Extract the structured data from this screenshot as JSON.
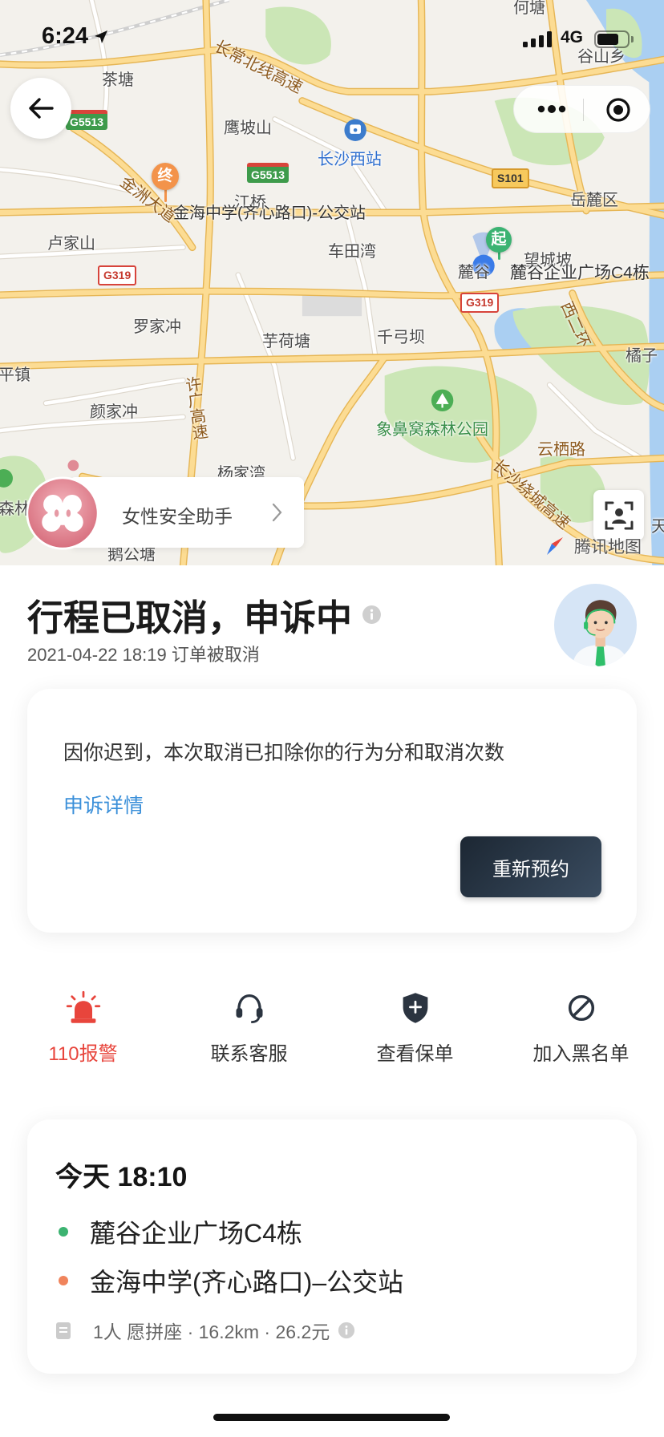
{
  "status_bar": {
    "time": "6:24",
    "network": "4G"
  },
  "map": {
    "labels": [
      "何塘",
      "谷山乡",
      "茶塘",
      "长常北线高速",
      "鹰坡山",
      "长沙西站",
      "岳麓区",
      "金洲大道",
      "江桥",
      "金海中学(齐心路口)-公交站",
      "卢家山",
      "车田湾",
      "望城坡",
      "麓谷",
      "麓谷企业广场C4栋",
      "罗家冲",
      "芋荷塘",
      "千弓坝",
      "西二环",
      "橘子",
      "平镇",
      "颜家冲",
      "许广高速",
      "象鼻窝森林公园",
      "云栖路",
      "长沙绕城高速",
      "杨家湾",
      "森林",
      "鹅公塘",
      "天"
    ],
    "road_shields": [
      "G5513",
      "G5513",
      "S101",
      "G319",
      "G319"
    ],
    "start_marker": "起",
    "end_marker": "终",
    "provider": "腾讯地图"
  },
  "safety_assistant": {
    "label": "女性安全助手"
  },
  "trip_status": {
    "title": "行程已取消，申诉中",
    "subtitle": "2021-04-22 18:19 订单被取消"
  },
  "notice_card": {
    "message": "因你迟到，本次取消已扣除你的行为分和取消次数",
    "appeal_link": "申诉详情",
    "rebook_button": "重新预约"
  },
  "actions": [
    {
      "label": "110报警",
      "icon": "alarm-icon"
    },
    {
      "label": "联系客服",
      "icon": "headset-icon"
    },
    {
      "label": "查看保单",
      "icon": "shield-plus-icon"
    },
    {
      "label": "加入黑名单",
      "icon": "block-icon"
    }
  ],
  "trip_card": {
    "time": "今天 18:10",
    "origin": "麓谷企业广场C4栋",
    "destination": "金海中学(齐心路口)–公交站",
    "details": "1人 愿拼座 · 16.2km · 26.2元"
  },
  "colors": {
    "alarm_red": "#e8453c",
    "link_blue": "#3a8fd9",
    "origin_green": "#3cb371",
    "destination_orange": "#f0845c",
    "button_dark": "#1c2733"
  }
}
